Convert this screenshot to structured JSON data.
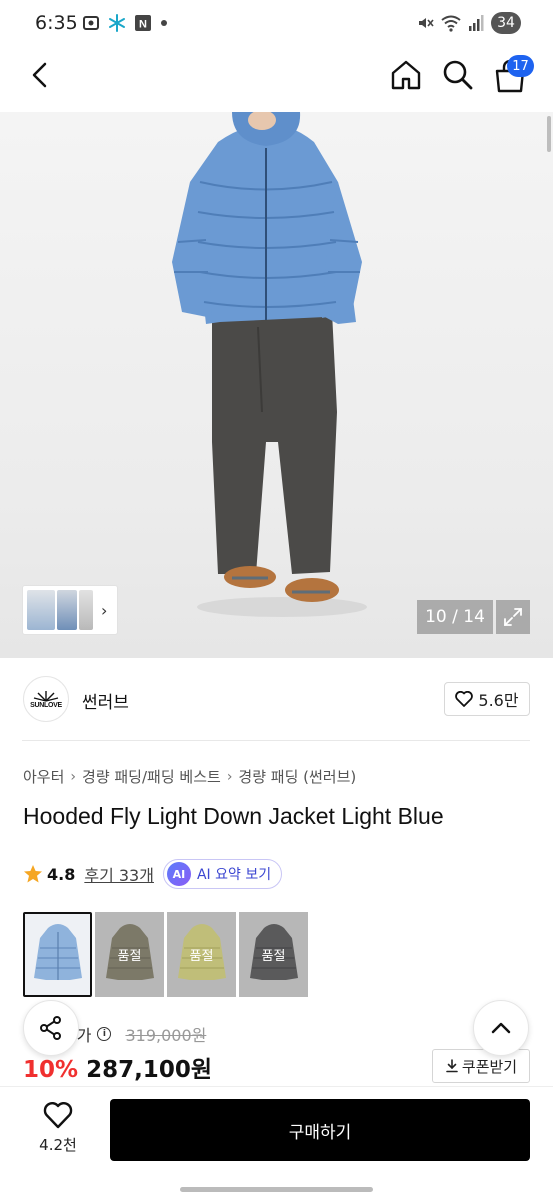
{
  "status_bar": {
    "time": "6:35",
    "battery": "34"
  },
  "nav": {
    "cart_count": "17"
  },
  "gallery": {
    "counter": "10 / 14"
  },
  "brand": {
    "logo_text": "SUNLOVE",
    "name": "썬러브",
    "likes": "5.6만"
  },
  "breadcrumb": [
    "아우터",
    "경량 패딩/패딩 베스트",
    "경량 패딩 (썬러브)"
  ],
  "product": {
    "title": "Hooded Fly Light Down Jacket Light Blue",
    "rating": "4.8",
    "reviews": "후기 33개",
    "ai_badge": "AI",
    "ai_label": "AI 요약 보기"
  },
  "options": [
    {
      "color": "Light Blue",
      "swatch": "#8fb3dc",
      "selected": true,
      "soldout_label": ""
    },
    {
      "color": "Olive",
      "swatch": "#7f7a60",
      "selected": false,
      "soldout_label": "품절"
    },
    {
      "color": "Yellow",
      "swatch": "#e6e37a",
      "selected": false,
      "soldout_label": "품절"
    },
    {
      "color": "Charcoal",
      "swatch": "#4a4a4c",
      "selected": false,
      "soldout_label": "품절"
    }
  ],
  "price": {
    "orig_label": "정가",
    "orig_price": "319,000원",
    "discount": "10%",
    "sale_price": "287,100원",
    "coupon_label": "쿠폰받기"
  },
  "bottom": {
    "wish_count": "4.2천",
    "buy_label": "구매하기"
  },
  "colors": {
    "accent": "#1e63f0",
    "discount": "#f0302f",
    "buy_bg": "#000000"
  }
}
